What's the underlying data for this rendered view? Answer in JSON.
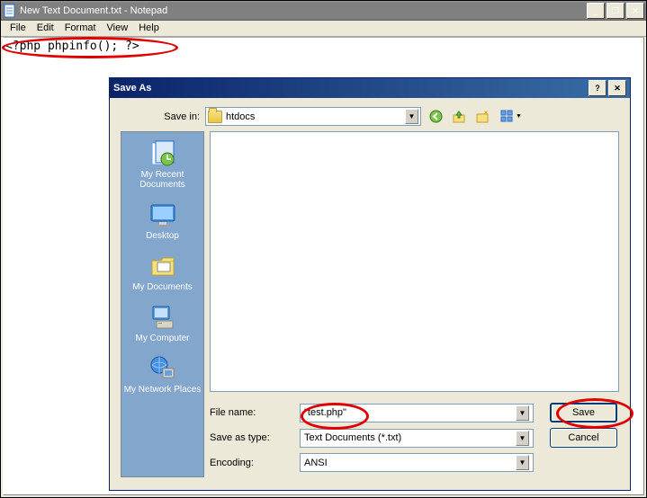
{
  "window": {
    "title": "New Text Document.txt - Notepad"
  },
  "menubar": {
    "items": [
      "File",
      "Edit",
      "Format",
      "View",
      "Help"
    ]
  },
  "editor": {
    "content": "<?php phpinfo(); ?>"
  },
  "dialog": {
    "title": "Save As",
    "savein_label": "Save in:",
    "savein_value": "htdocs",
    "toolbar_icons": [
      "back-icon",
      "up-icon",
      "new-folder-icon",
      "views-icon"
    ],
    "sidebar": {
      "items": [
        {
          "label": "My Recent Documents",
          "icon": "recent-docs-icon"
        },
        {
          "label": "Desktop",
          "icon": "desktop-icon"
        },
        {
          "label": "My Documents",
          "icon": "my-documents-icon"
        },
        {
          "label": "My Computer",
          "icon": "my-computer-icon"
        },
        {
          "label": "My Network Places",
          "icon": "network-places-icon"
        }
      ]
    },
    "filename_label": "File name:",
    "filename_value": "\"test.php\"",
    "saveastype_label": "Save as type:",
    "saveastype_value": "Text Documents (*.txt)",
    "encoding_label": "Encoding:",
    "encoding_value": "ANSI",
    "save_btn": "Save",
    "cancel_btn": "Cancel"
  }
}
